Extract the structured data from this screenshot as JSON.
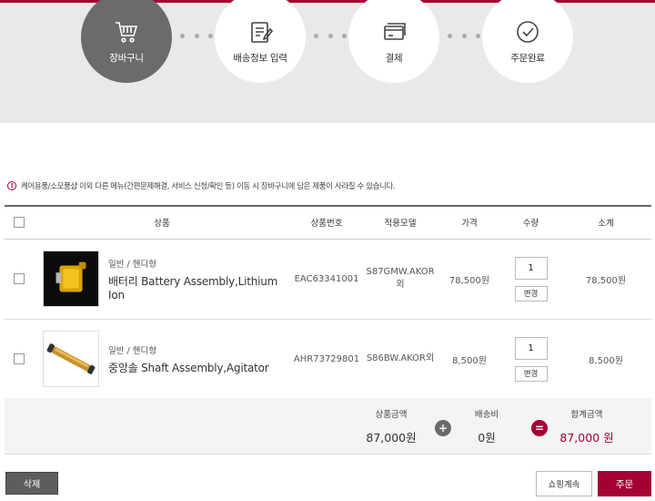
{
  "steps": [
    {
      "label": "장바구니",
      "icon": "cart-icon",
      "active": true
    },
    {
      "label": "배송정보 입력",
      "icon": "clipboard-icon",
      "active": false
    },
    {
      "label": "결제",
      "icon": "card-icon",
      "active": false
    },
    {
      "label": "주문완료",
      "icon": "check-circle-icon",
      "active": false
    }
  ],
  "notice": "케어용품/소모품샵 이외 다른 메뉴(간편문제해결, 서비스 신청/확인 등) 이동 시 장바구니에 담은 제품이 사라질 수 있습니다.",
  "table": {
    "headers": [
      "상품",
      "상품번호",
      "적용모델",
      "가격",
      "수량",
      "소계"
    ],
    "rows": [
      {
        "category": "일반 / 핸디형",
        "name": "배터리 Battery Assembly,Lithium Ion",
        "product_no": "EAC63341001",
        "model": "S87GMW.AKOR외",
        "price": "78,500원",
        "qty": "1",
        "change": "변경",
        "subtotal": "78,500원"
      },
      {
        "category": "일반 / 핸디형",
        "name": "중앙솔 Shaft Assembly,Agitator",
        "product_no": "AHR73729801",
        "model": "S86BW.AKOR외",
        "price": "8,500원",
        "qty": "1",
        "change": "변경",
        "subtotal": "8,500원"
      }
    ]
  },
  "totals": {
    "product_label": "상품금액",
    "product_value": "87,000원",
    "shipping_label": "배송비",
    "shipping_value": "0원",
    "total_label": "합계금액",
    "total_value": "87,000 원",
    "plus": "+",
    "equals": "="
  },
  "buttons": {
    "delete": "삭제",
    "continue": "쇼핑계속",
    "order": "주문"
  },
  "colors": {
    "brand": "#a50034",
    "step_active": "#6b6b6b",
    "plus_op": "#6a6a6a"
  }
}
